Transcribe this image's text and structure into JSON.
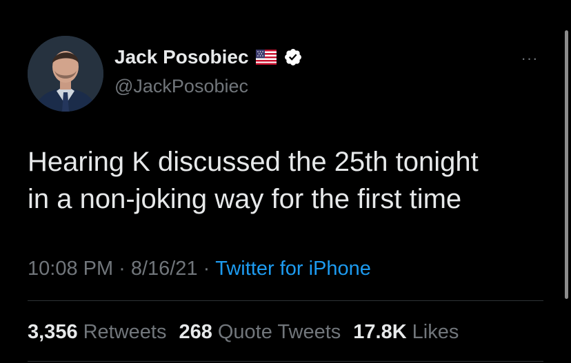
{
  "author": {
    "display_name": "Jack Posobiec",
    "handle": "@JackPosobiec",
    "avatar_icon": "profile-photo",
    "flag_icon": "us-flag-icon",
    "verified_icon": "verified-badge-icon"
  },
  "more_icon_label": "···",
  "tweet": {
    "text_lines": [
      "Hearing K discussed the 25th tonight",
      "in a non-joking way for the first time"
    ],
    "time": "10:08 PM",
    "date": "8/16/21",
    "separator": "·",
    "source": "Twitter for iPhone"
  },
  "stats": {
    "retweets_count": "3,356",
    "retweets_label": "Retweets",
    "quotes_count": "268",
    "quotes_label": "Quote Tweets",
    "likes_count": "17.8K",
    "likes_label": "Likes"
  },
  "colors": {
    "background": "#000000",
    "primary_text": "#e7e9ea",
    "secondary_text": "#71767b",
    "link": "#1d9bf0",
    "divider": "#2f3336",
    "verified_badge": "#ffffff"
  }
}
